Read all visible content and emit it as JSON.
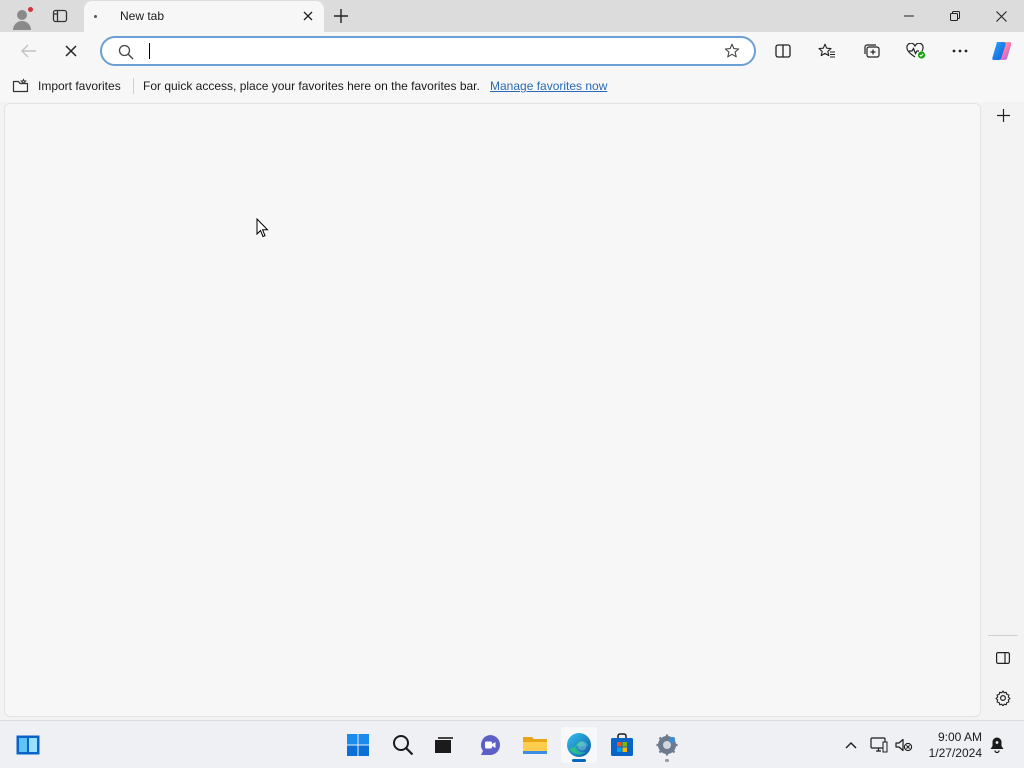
{
  "browser": {
    "tab": {
      "title": "New tab"
    },
    "address_bar": {
      "value": "",
      "placeholder": ""
    },
    "favorites_bar": {
      "import_label": "Import favorites",
      "message": "For quick access, place your favorites here on the favorites bar.",
      "link": "Manage favorites now"
    },
    "icons": {
      "profile": "profile-icon",
      "tab_actions": "tab-actions-icon",
      "close_tab": "close-icon",
      "new_tab": "plus-icon",
      "back": "back-arrow-icon",
      "stop": "stop-icon",
      "search": "search-icon",
      "favorite": "star-icon",
      "split": "split-screen-icon",
      "favorites": "favorites-icon",
      "collections": "collections-icon",
      "performance": "performance-icon",
      "more": "more-icon",
      "copilot": "copilot-icon"
    }
  },
  "taskbar": {
    "time": "9:00 AM",
    "date": "1/27/2024",
    "apps": [
      "widgets",
      "start",
      "search",
      "task-view",
      "chat",
      "file-explorer",
      "edge",
      "store",
      "settings"
    ]
  },
  "colors": {
    "accent": "#0067c0",
    "link": "#2a6bb8",
    "address_border": "#6b9fd6",
    "profile_badge": "#d13438"
  }
}
